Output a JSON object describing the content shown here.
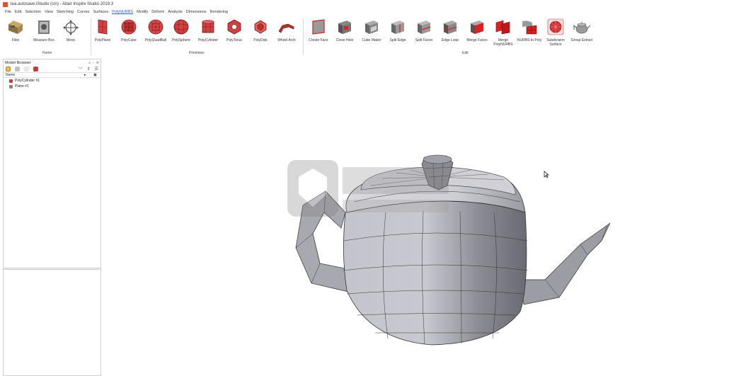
{
  "window": {
    "title": "tea.autosave.iStudio (cm) - Altair Inspire Studio 2019.3"
  },
  "menu": {
    "items": [
      "File",
      "Edit",
      "Selection",
      "View",
      "Sketching",
      "Curves",
      "Surfaces",
      "PolyNURBS",
      "Modify",
      "Deform",
      "Analysis",
      "Dimensions",
      "Rendering"
    ],
    "active": "PolyNURBS"
  },
  "ribbon": {
    "groups": {
      "home": "Home",
      "primitives": "Primitives",
      "edit": "Edit"
    },
    "tools": {
      "files": "Files",
      "measure_box": "Measure Box",
      "move": "Move",
      "polyplane": "PolyPlane",
      "polycube": "PolyCube",
      "polyquadball": "PolyQuadBall",
      "polysphere": "PolySphere",
      "polycylinder": "PolyCylinder",
      "polytorus": "PolyTorus",
      "polydisk": "PolyDisk",
      "wheel_arch": "Wheel Arch",
      "create_face": "Create Face",
      "close_hole": "Close Hole",
      "cube_maker": "Cube Maker",
      "split_edge": "Split Edge",
      "split_faces": "Split Faces",
      "edge_loop": "Edge Loop",
      "merge_faces": "Merge Faces",
      "merge_polynurbs_1": "Merge",
      "merge_polynurbs_2": "PolyNURBS",
      "nurbs_to_poly": "NURBS to Poly",
      "subdivision_1": "Subdivision",
      "subdivision_2": "Surface",
      "group_extract": "Group Extract"
    }
  },
  "model_browser": {
    "title": "Model Browser",
    "column_name": "Name",
    "items": [
      "PolyCylinder #1",
      "Plane #1"
    ]
  },
  "colors": {
    "accent": "#3060c0",
    "brand": "#e8501e",
    "edit_red": "#e02020"
  }
}
